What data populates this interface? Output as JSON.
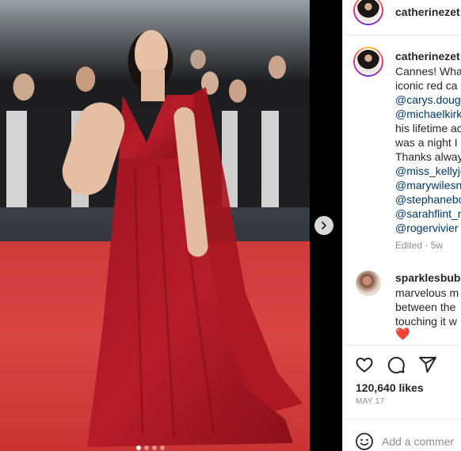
{
  "post": {
    "username": "catherinezet",
    "caption_lines": [
      {
        "text": "Cannes! Wha",
        "mention": false
      },
      {
        "text": "iconic red ca",
        "mention": false
      },
      {
        "text": "@carys.doug",
        "mention": true
      },
      {
        "text": "@michaelkirk",
        "mention": true
      },
      {
        "text": "his lifetime ac",
        "mention": false
      },
      {
        "text": "was a night I",
        "mention": false
      },
      {
        "text": "Thanks alway",
        "mention": false
      },
      {
        "text": "@miss_kellyjo",
        "mention": true
      },
      {
        "text": "@marywilesn",
        "mention": true
      },
      {
        "text": "@stephanebo",
        "mention": true
      },
      {
        "text": "@sarahflint_n",
        "mention": true
      },
      {
        "text": "@rogervivier",
        "mention": true
      }
    ],
    "edited_label": "Edited · 5w",
    "likes": "120,640 likes",
    "date": "MAY 17",
    "add_comment_placeholder": "Add a commer"
  },
  "comment": {
    "username": "sparklesbub",
    "lines": [
      "marvelous m",
      "between the",
      "touching it w"
    ],
    "emoji": "❤️"
  },
  "carousel": {
    "dot_count": 4,
    "active_index": 0
  },
  "icons": {
    "like": "heart-icon",
    "comment": "comment-icon",
    "share": "share-icon",
    "next": "chevron-right-icon",
    "emoji": "emoji-icon"
  }
}
